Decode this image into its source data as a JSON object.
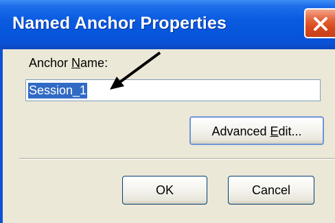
{
  "dialog": {
    "title": "Named Anchor Properties",
    "close_icon": "close-icon",
    "anchor_name_label_prefix": "Anchor ",
    "anchor_name_label_mnemonic": "N",
    "anchor_name_label_suffix": "ame:",
    "anchor_name_value": "Session_1",
    "advanced_edit_prefix": "Advanced ",
    "advanced_edit_mnemonic": "E",
    "advanced_edit_suffix": "dit...",
    "ok_label": "OK",
    "cancel_label": "Cancel"
  },
  "annotation": {
    "icon": "arrow-pointer-icon",
    "color": "#000000"
  },
  "colors": {
    "titlebar": "#0a5be0",
    "panel": "#ebe8d7",
    "selection": "#316ac5",
    "close_button": "#d84a1c"
  }
}
